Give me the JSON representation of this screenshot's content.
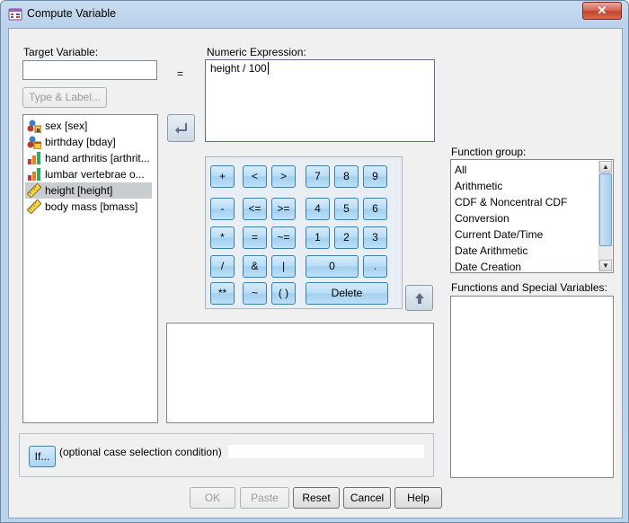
{
  "window": {
    "title": "Compute Variable",
    "close": "✕"
  },
  "target": {
    "label": "Target Variable:",
    "value": "",
    "type_label_btn": "Type & Label..."
  },
  "equals": "=",
  "expression": {
    "label": "Numeric Expression:",
    "value": "height / 100"
  },
  "variables": [
    {
      "label": "sex [sex]",
      "icon": "nominal-string-icon",
      "selected": false
    },
    {
      "label": "birthday [bday]",
      "icon": "date-nominal-icon",
      "selected": false
    },
    {
      "label": "hand arthritis [arthrit...",
      "icon": "ordinal-icon",
      "selected": false
    },
    {
      "label": "lumbar vertebrae o...",
      "icon": "ordinal-icon",
      "selected": false
    },
    {
      "label": "height [height]",
      "icon": "scale-ruler-icon",
      "selected": true
    },
    {
      "label": "body mass [bmass]",
      "icon": "scale-ruler-icon",
      "selected": false
    }
  ],
  "keypad": {
    "row1": [
      "+",
      "<",
      ">",
      "7",
      "8",
      "9"
    ],
    "row2": [
      "-",
      "<=",
      ">=",
      "4",
      "5",
      "6"
    ],
    "row3": [
      "*",
      "=",
      "~=",
      "1",
      "2",
      "3"
    ],
    "row4": [
      "/",
      "&",
      "|",
      "0",
      "."
    ],
    "row5": [
      "**",
      "~",
      "( )",
      "Delete"
    ]
  },
  "function_group": {
    "label": "Function group:",
    "items": [
      "All",
      "Arithmetic",
      "CDF & Noncentral CDF",
      "Conversion",
      "Current Date/Time",
      "Date Arithmetic",
      "Date Creation"
    ]
  },
  "functions": {
    "label": "Functions and Special Variables:"
  },
  "if": {
    "button": "If...",
    "text": "(optional case selection condition)"
  },
  "buttons": {
    "ok": "OK",
    "paste": "Paste",
    "reset": "Reset",
    "cancel": "Cancel",
    "help": "Help"
  },
  "colors": {
    "key_fill": "#b8dcf5",
    "key_border": "#3c7fb1",
    "selection": "#c9cdd2",
    "frame": "#bcd3ec"
  }
}
